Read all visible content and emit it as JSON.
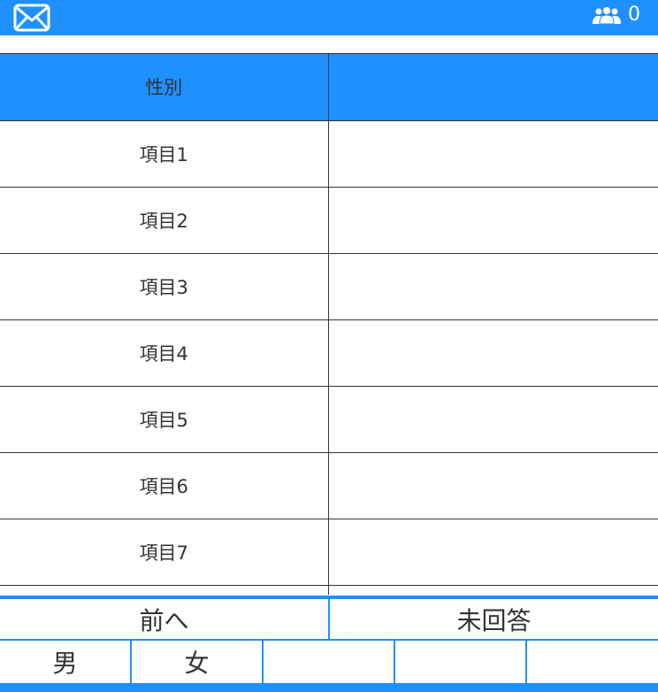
{
  "header": {
    "mail_icon": "mail-icon",
    "users_icon": "users-icon",
    "users_count": "0"
  },
  "table": {
    "header": {
      "label": "性別",
      "value": ""
    },
    "rows": [
      {
        "label": "項目1",
        "value": ""
      },
      {
        "label": "項目2",
        "value": ""
      },
      {
        "label": "項目3",
        "value": ""
      },
      {
        "label": "項目4",
        "value": ""
      },
      {
        "label": "項目5",
        "value": ""
      },
      {
        "label": "項目6",
        "value": ""
      },
      {
        "label": "項目7",
        "value": ""
      },
      {
        "label": "",
        "value": ""
      }
    ]
  },
  "nav": {
    "prev_label": "前へ",
    "unanswered_label": "未回答"
  },
  "choices": [
    "男",
    "女",
    "",
    "",
    ""
  ],
  "colors": {
    "accent": "#1e90ff",
    "text": "#333333",
    "border": "#333333"
  }
}
